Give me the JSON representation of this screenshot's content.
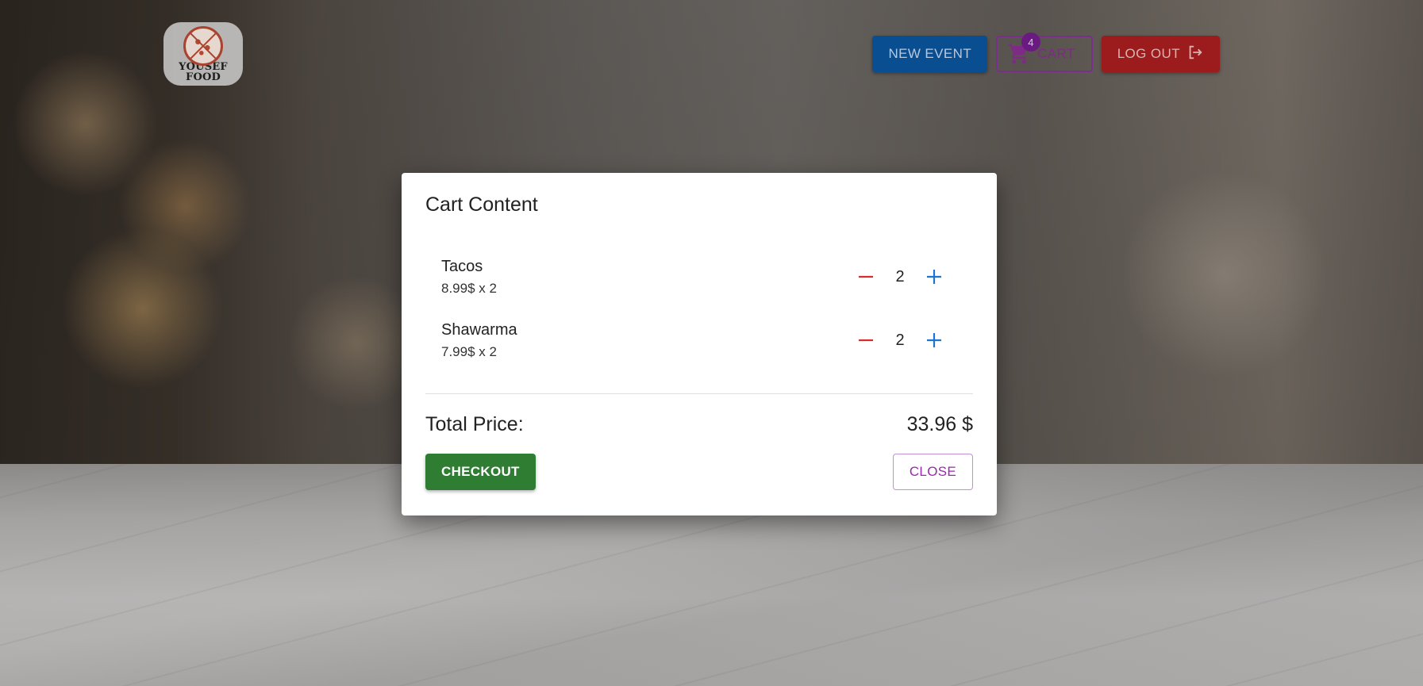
{
  "brand": {
    "logo_text_line1": "YOUSEF",
    "logo_text_line2": "FOOD"
  },
  "nav": {
    "new_event_label": "NEW EVENT",
    "cart_label": "CART",
    "cart_count": "4",
    "logout_label": "LOG OUT"
  },
  "modal": {
    "title": "Cart Content",
    "items": [
      {
        "name": "Tacos",
        "price_line": "8.99$ x 2",
        "quantity": "2"
      },
      {
        "name": "Shawarma",
        "price_line": "7.99$ x 2",
        "quantity": "2"
      }
    ],
    "total_label": "Total Price:",
    "total_value": "33.96 $",
    "checkout_label": "CHECKOUT",
    "close_label": "CLOSE"
  },
  "colors": {
    "new_event": "#0a4e92",
    "cart_outline": "#7b2e8b",
    "logout": "#9c1b1c",
    "checkout": "#2e7d32",
    "close_text": "#9c27b0",
    "decrement": "#d32f2f",
    "increment": "#1976d2"
  },
  "icons": {
    "cart": "cart-icon",
    "logout": "logout-icon",
    "decrement": "minus-icon",
    "increment": "plus-icon"
  }
}
